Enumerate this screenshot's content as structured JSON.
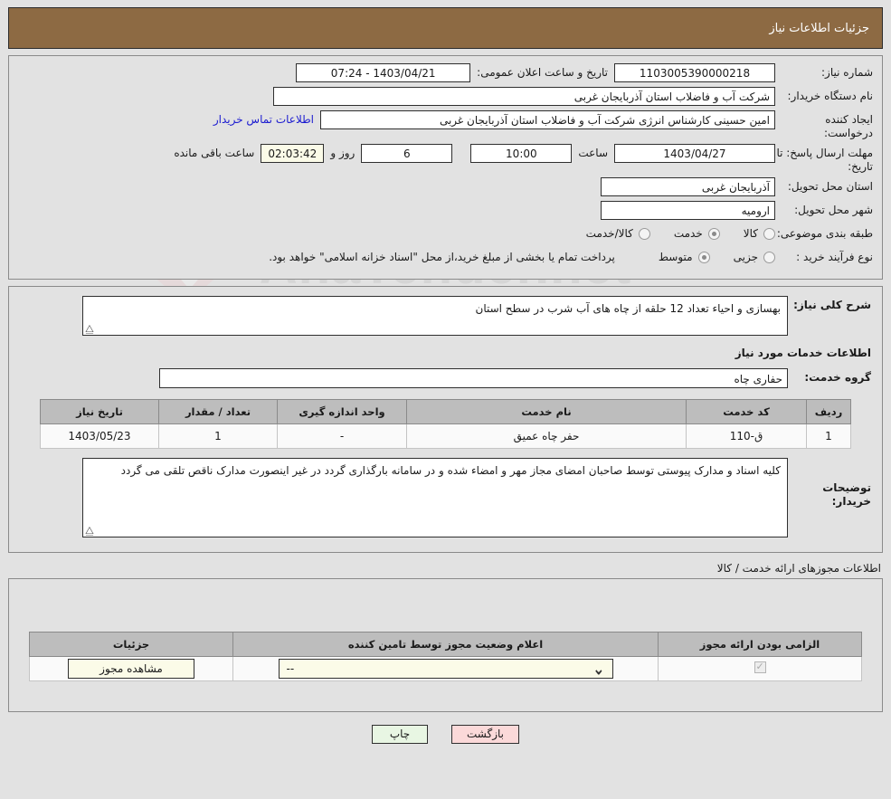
{
  "header": {
    "title": "جزئیات اطلاعات نیاز"
  },
  "info": {
    "need_number_label": "شماره نیاز:",
    "need_number_value": "1103005390000218",
    "announce_label": "تاریخ و ساعت اعلان عمومی:",
    "announce_value": "1403/04/21 - 07:24",
    "buyer_org_label": "نام دستگاه خریدار:",
    "buyer_org_value": "شرکت آب و فاضلاب استان آذربایجان غربی",
    "creator_label": "ایجاد کننده درخواست:",
    "creator_value": "امین حسینی کارشناس انرژی شرکت آب و فاضلاب استان آذربایجان غربی",
    "creator_org_value": "شرکت آب و فاضلاب استان آذربایجان غربی",
    "contact_link": "اطلاعات تماس خریدار",
    "deadline_label": "مهلت ارسال پاسخ: تا تاریخ:",
    "deadline_date": "1403/04/27",
    "hour_label": "ساعت",
    "hour_value": "10:00",
    "days_value": "6",
    "days_label": "روز و",
    "countdown_value": "02:03:42",
    "countdown_label": "ساعت باقی مانده",
    "province_label": "استان محل تحویل:",
    "province_value": "آذربایجان غربی",
    "city_label": "شهر محل تحویل:",
    "city_value": "ارومیه",
    "category_label": "طبقه بندی موضوعی:",
    "category_options": [
      {
        "label": "کالا",
        "selected": false
      },
      {
        "label": "خدمت",
        "selected": true
      },
      {
        "label": "کالا/خدمت",
        "selected": false
      }
    ],
    "process_label": "نوع فرآیند خرید :",
    "process_options": [
      {
        "label": "جزیی",
        "selected": false
      },
      {
        "label": "متوسط",
        "selected": true
      }
    ],
    "process_note": "پرداخت تمام یا بخشی از مبلغ خرید،از محل \"اسناد خزانه اسلامی\" خواهد بود."
  },
  "need": {
    "summary_label": "شرح کلی نیاز:",
    "summary_value": "بهسازی و احیاء تعداد 12 حلقه از چاه های آب شرب در سطح استان",
    "services_section_title": "اطلاعات خدمات مورد نیاز",
    "service_group_label": "گروه خدمت:",
    "service_group_value": "حفاری چاه",
    "table": {
      "headers": [
        "ردیف",
        "کد خدمت",
        "نام خدمت",
        "واحد اندازه گیری",
        "تعداد / مقدار",
        "تاریخ نیاز"
      ],
      "rows": [
        [
          "1",
          "ق-110",
          "حفر چاه عمیق",
          "-",
          "1",
          "1403/05/23"
        ]
      ]
    },
    "buyer_notes_label": "توضیحات خریدار:",
    "buyer_notes_value": "کلیه اسناد و مدارک پیوستی توسط صاحبان امضای مجاز مهر و امضاء شده و در سامانه بارگذاری گردد در غیر اینصورت مدارک ناقص تلقی می گردد"
  },
  "licenses": {
    "caption": "اطلاعات مجوزهای ارائه خدمت / کالا",
    "headers": [
      "الزامی بودن ارائه مجوز",
      "اعلام وضعیت مجوز توسط تامین کننده",
      "جزئیات"
    ],
    "rows": [
      {
        "required_checked": true,
        "status_value": "--",
        "detail_button": "مشاهده مجوز"
      }
    ]
  },
  "footer": {
    "print_label": "چاپ",
    "back_label": "بازگشت"
  },
  "watermark": {
    "text": "AnaTender.net"
  }
}
